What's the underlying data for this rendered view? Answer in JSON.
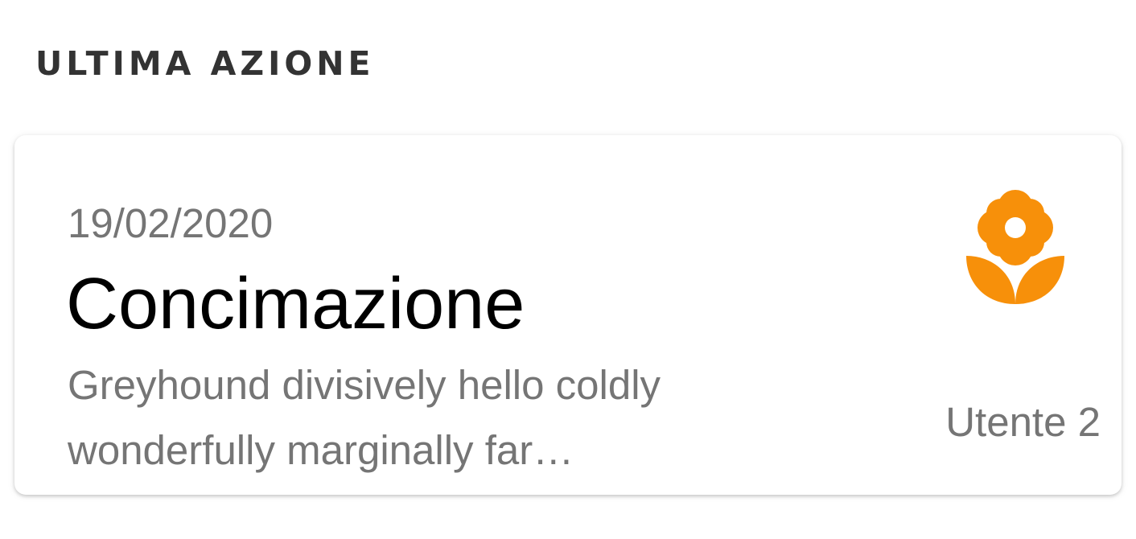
{
  "section": {
    "title": "ULTIMA AZIONE"
  },
  "last_action": {
    "date": "19/02/2020",
    "title": "Concimazione",
    "description_line1": "Greyhound divisively hello coldly",
    "description_line2": "wonderfully marginally far…",
    "user": "Utente 2",
    "icon": "flower-icon",
    "icon_color": "#F7900A"
  }
}
